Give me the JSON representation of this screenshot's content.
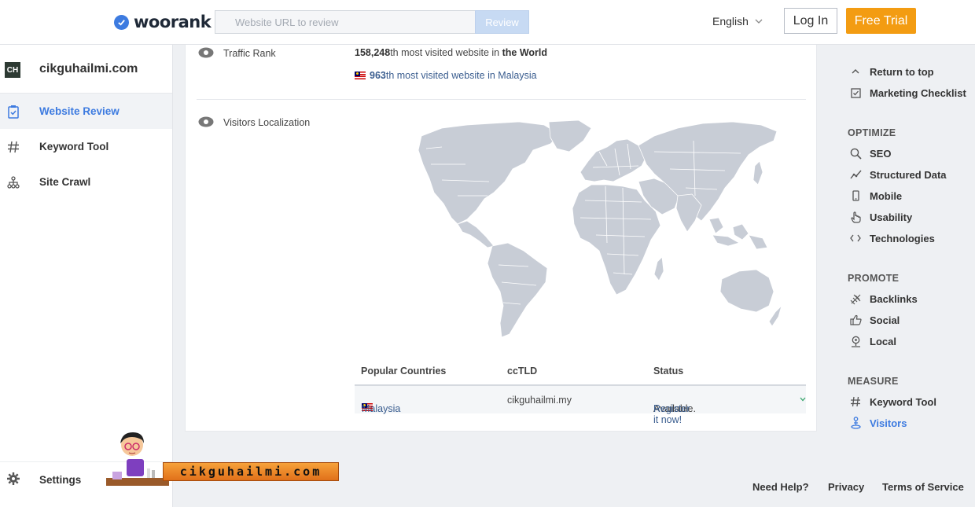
{
  "header": {
    "logo_text": "woorank",
    "search_placeholder": "Website URL to review",
    "review_label": "Review",
    "language": "English",
    "login_label": "Log In",
    "trial_label": "Free Trial",
    "brand_color": "#3d7be0",
    "accent_color": "#f39c12"
  },
  "sidebar": {
    "favicon_text": "CH",
    "site_name": "cikguhailmi.com",
    "items": [
      {
        "label": "Website Review",
        "icon": "clipboard-check-icon",
        "active": true
      },
      {
        "label": "Keyword Tool",
        "icon": "hashtag-icon",
        "active": false
      },
      {
        "label": "Site Crawl",
        "icon": "sitemap-icon",
        "active": false
      }
    ],
    "settings_label": "Settings"
  },
  "main": {
    "traffic_rank": {
      "label": "Traffic Rank",
      "world_value": "158,248",
      "world_suffix": "th most visited website in ",
      "world_region": "the World",
      "country_value": "963",
      "country_text": "th most visited website in Malaysia"
    },
    "visitors_localization": {
      "label": "Visitors Localization",
      "table": {
        "headers": [
          "Popular Countries",
          "ccTLD",
          "Status"
        ],
        "rows": [
          {
            "country": "Malaysia",
            "cctld": "cikguhailmi.my",
            "status_text": "Available.",
            "status_link": "Register it now!"
          }
        ]
      }
    }
  },
  "right_nav": {
    "top": [
      {
        "label": "Return to top",
        "icon": "chevron-up-icon"
      },
      {
        "label": "Marketing Checklist",
        "icon": "checkbox-icon"
      }
    ],
    "sections": [
      {
        "title": "OPTIMIZE",
        "items": [
          {
            "label": "SEO",
            "icon": "search-icon"
          },
          {
            "label": "Structured Data",
            "icon": "chart-line-icon"
          },
          {
            "label": "Mobile",
            "icon": "mobile-icon"
          },
          {
            "label": "Usability",
            "icon": "hand-pointer-icon"
          },
          {
            "label": "Technologies",
            "icon": "code-icon"
          }
        ]
      },
      {
        "title": "PROMOTE",
        "items": [
          {
            "label": "Backlinks",
            "icon": "link-icon"
          },
          {
            "label": "Social",
            "icon": "thumbs-up-icon"
          },
          {
            "label": "Local",
            "icon": "map-pin-icon"
          }
        ]
      },
      {
        "title": "MEASURE",
        "items": [
          {
            "label": "Keyword Tool",
            "icon": "hashtag-icon"
          },
          {
            "label": "Visitors",
            "icon": "person-pin-icon",
            "active": true
          }
        ]
      }
    ]
  },
  "footer": {
    "links": [
      "Need Help?",
      "Privacy",
      "Terms of Service"
    ]
  },
  "watermark": {
    "text": "cikguhailmi.com"
  }
}
